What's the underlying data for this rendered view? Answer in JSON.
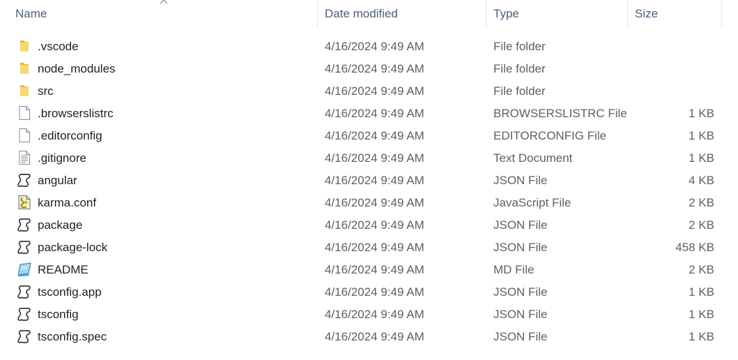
{
  "columns": {
    "name": "Name",
    "date": "Date modified",
    "type": "Type",
    "size": "Size"
  },
  "sort": {
    "column": "name",
    "direction": "ascending",
    "icon": "sort-up-arrow"
  },
  "files": [
    {
      "name": ".vscode",
      "date": "4/16/2024 9:49 AM",
      "type": "File folder",
      "size": "",
      "icon": "folder-icon"
    },
    {
      "name": "node_modules",
      "date": "4/16/2024 9:49 AM",
      "type": "File folder",
      "size": "",
      "icon": "folder-icon"
    },
    {
      "name": "src",
      "date": "4/16/2024 9:49 AM",
      "type": "File folder",
      "size": "",
      "icon": "folder-icon"
    },
    {
      "name": ".browserslistrc",
      "date": "4/16/2024 9:49 AM",
      "type": "BROWSERSLISTRC File",
      "size": "1 KB",
      "icon": "blank-file-icon"
    },
    {
      "name": ".editorconfig",
      "date": "4/16/2024 9:49 AM",
      "type": "EDITORCONFIG File",
      "size": "1 KB",
      "icon": "blank-file-icon"
    },
    {
      "name": ".gitignore",
      "date": "4/16/2024 9:49 AM",
      "type": "Text Document",
      "size": "1 KB",
      "icon": "text-file-icon"
    },
    {
      "name": "angular",
      "date": "4/16/2024 9:49 AM",
      "type": "JSON File",
      "size": "4 KB",
      "icon": "json-file-icon"
    },
    {
      "name": "karma.conf",
      "date": "4/16/2024 9:49 AM",
      "type": "JavaScript File",
      "size": "2 KB",
      "icon": "javascript-file-icon"
    },
    {
      "name": "package",
      "date": "4/16/2024 9:49 AM",
      "type": "JSON File",
      "size": "2 KB",
      "icon": "json-file-icon"
    },
    {
      "name": "package-lock",
      "date": "4/16/2024 9:49 AM",
      "type": "JSON File",
      "size": "458 KB",
      "icon": "json-file-icon"
    },
    {
      "name": "README",
      "date": "4/16/2024 9:49 AM",
      "type": "MD File",
      "size": "2 KB",
      "icon": "markdown-file-icon"
    },
    {
      "name": "tsconfig.app",
      "date": "4/16/2024 9:49 AM",
      "type": "JSON File",
      "size": "1 KB",
      "icon": "json-file-icon"
    },
    {
      "name": "tsconfig",
      "date": "4/16/2024 9:49 AM",
      "type": "JSON File",
      "size": "1 KB",
      "icon": "json-file-icon"
    },
    {
      "name": "tsconfig.spec",
      "date": "4/16/2024 9:49 AM",
      "type": "JSON File",
      "size": "1 KB",
      "icon": "json-file-icon"
    }
  ],
  "colors": {
    "header_text": "#4c607a",
    "name_text": "#1f1f1f",
    "detail_text": "#5f5f5f",
    "folder": "#f8d775",
    "folder_dark": "#e8b83e"
  }
}
